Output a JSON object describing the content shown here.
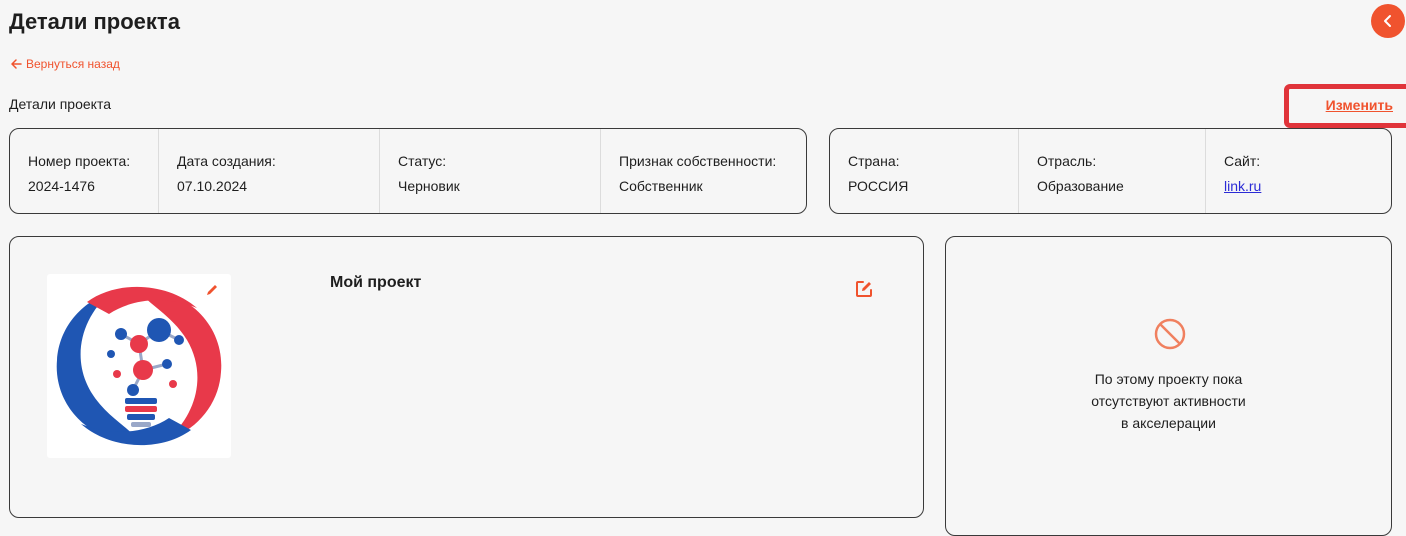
{
  "header": {
    "title": "Детали проекта"
  },
  "nav": {
    "back_label": "Вернуться назад"
  },
  "section": {
    "title": "Детали проекта",
    "edit_label": "Изменить"
  },
  "info_left": [
    {
      "label": "Номер проекта:",
      "value": "2024-1476"
    },
    {
      "label": "Дата создания:",
      "value": "07.10.2024"
    },
    {
      "label": "Статус:",
      "value": "Черновик"
    },
    {
      "label": "Признак собственности:",
      "value": "Собственник"
    }
  ],
  "info_right": [
    {
      "label": "Страна:",
      "value": "РОССИЯ"
    },
    {
      "label": "Отрасль:",
      "value": "Образование"
    },
    {
      "label": "Сайт:",
      "value": "link.ru"
    }
  ],
  "project": {
    "name": "Мой проект"
  },
  "activity": {
    "empty_text": "По этому проекту пока отсутствуют активности в акселерации"
  },
  "colors": {
    "accent": "#f0532e",
    "link": "#2b2bd6",
    "border": "#3a3a3a",
    "highlight": "#e0343a"
  },
  "icons": [
    "chevron-left-icon",
    "arrow-left-icon",
    "pencil-icon",
    "edit-icon",
    "no-entry-icon",
    "lightbulb-logo"
  ]
}
